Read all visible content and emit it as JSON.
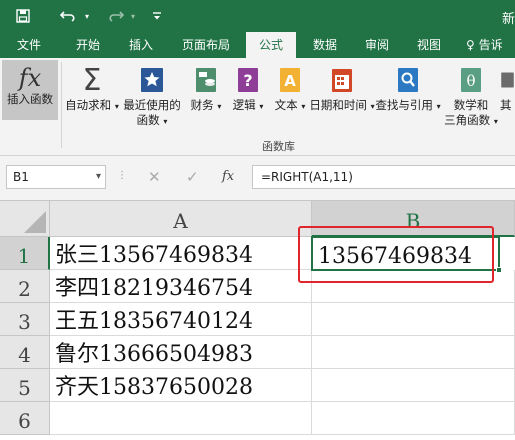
{
  "window": {
    "title": "新"
  },
  "quick_access": {
    "save_icon": "save-icon",
    "undo_icon": "undo-icon",
    "redo_icon": "redo-icon",
    "customize_icon": "customize-icon"
  },
  "tabs": [
    {
      "label": "文件",
      "active": false
    },
    {
      "label": "开始",
      "active": false
    },
    {
      "label": "插入",
      "active": false
    },
    {
      "label": "页面布局",
      "active": false
    },
    {
      "label": "公式",
      "active": true
    },
    {
      "label": "数据",
      "active": false
    },
    {
      "label": "审阅",
      "active": false
    },
    {
      "label": "视图",
      "active": false
    }
  ],
  "tell_me": "♀ 告诉",
  "ribbon": {
    "group_label": "函数库",
    "buttons": [
      {
        "label": "插入函数",
        "icon": "fx-icon"
      },
      {
        "label": "自动求和",
        "icon": "sigma-icon",
        "dropdown": true
      },
      {
        "label": "最近使用的",
        "label2": "函数",
        "icon": "star-icon",
        "dropdown": true
      },
      {
        "label": "财务",
        "icon": "finance-icon",
        "dropdown": true
      },
      {
        "label": "逻辑",
        "icon": "logic-icon",
        "dropdown": true
      },
      {
        "label": "文本",
        "icon": "text-icon",
        "dropdown": true
      },
      {
        "label": "日期和时间",
        "icon": "calendar-icon",
        "dropdown": true
      },
      {
        "label": "查找与引用",
        "icon": "lookup-icon",
        "dropdown": true
      },
      {
        "label": "数学和",
        "label2": "三角函数",
        "icon": "theta-icon",
        "dropdown": true
      },
      {
        "label": "其",
        "icon": "more-icon"
      }
    ]
  },
  "formula_bar": {
    "name_box": "B1",
    "fx_label": "fx",
    "formula": "=RIGHT(A1,11)"
  },
  "sheet": {
    "columns": [
      "A",
      "B"
    ],
    "rows": [
      "1",
      "2",
      "3",
      "4",
      "5",
      "6"
    ],
    "cells_a": [
      "张三13567469834",
      "李四18219346754",
      "王五18356740124",
      "鲁尔13666504983",
      "齐天15837650028",
      ""
    ],
    "cells_b": [
      "13567469834",
      "",
      "",
      "",
      "",
      ""
    ],
    "selected_cell": "B1"
  },
  "colors": {
    "excel_green": "#217346",
    "highlight_red": "#e0262b"
  }
}
